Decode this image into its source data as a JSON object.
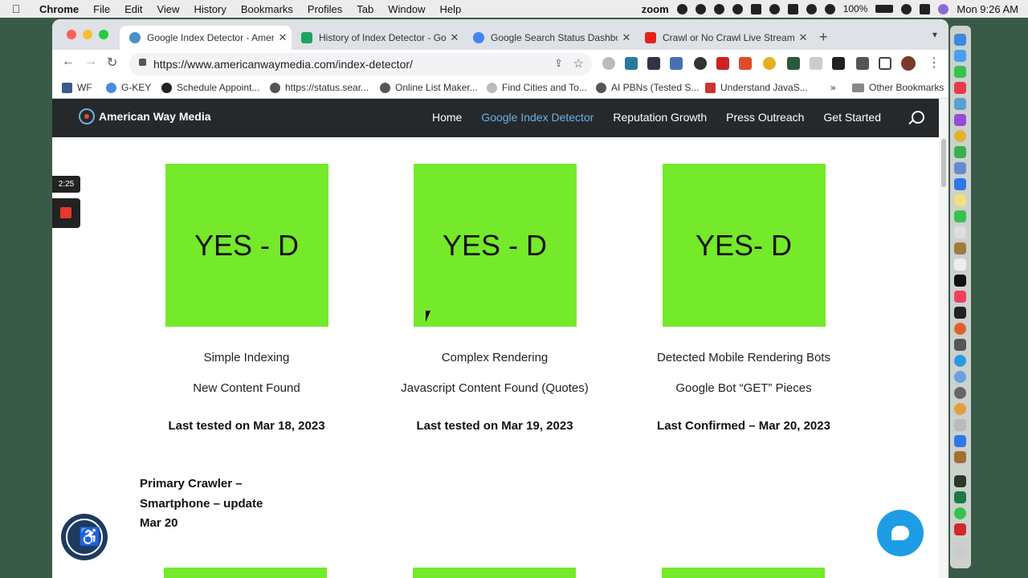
{
  "menubar": {
    "app": "Chrome",
    "items": [
      "File",
      "Edit",
      "View",
      "History",
      "Bookmarks",
      "Profiles",
      "Tab",
      "Window",
      "Help"
    ],
    "zoom_label": "zoom",
    "battery": "100%",
    "clock": "Mon  9:26 AM"
  },
  "tabs": [
    {
      "title": "Google Index Detector - Ameri",
      "favicon_color": "#4a90c8"
    },
    {
      "title": "History of Index Detector - Go",
      "favicon_color": "#1ea362"
    },
    {
      "title": "Google Search Status Dashboa",
      "favicon_color": "#4285f4"
    },
    {
      "title": "Crawl or No Crawl Live Stream",
      "favicon_color": "#e62117"
    }
  ],
  "address_bar": {
    "url": "https://www.americanwaymedia.com/index-detector/"
  },
  "bookmarks": [
    "WF",
    "G-KEY",
    "Schedule Appoint...",
    "https://status.sear...",
    "Online List Maker...",
    "Find Cities and To...",
    "AI PBNs (Tested S...",
    "Understand JavaS...",
    "Other Bookmarks"
  ],
  "bookmarks_overflow": "»",
  "site": {
    "logo_text": "American Way Media",
    "nav": [
      "Home",
      "Google Index Detector",
      "Reputation Growth",
      "Press Outreach",
      "Get Started"
    ],
    "columns": [
      {
        "box_text": "YES - D",
        "line1": "Simple Indexing",
        "line2": "New Content Found",
        "line3": "Last tested on Mar 18, 2023"
      },
      {
        "box_text": "YES - D",
        "line1": "Complex Rendering",
        "line2": "Javascript Content Found (Quotes)",
        "line3": "Last tested on Mar 19, 2023"
      },
      {
        "box_text": "YES- D",
        "line1": "Detected Mobile Rendering Bots",
        "line2": "Google Bot “GET” Pieces",
        "line3": "Last Confirmed – Mar 20, 2023"
      }
    ],
    "primary_crawler": [
      "Primary Crawler –",
      "Smartphone – update",
      "Mar 20"
    ],
    "box_color": "#74ea2a"
  },
  "recorder": {
    "time": "2:25"
  }
}
